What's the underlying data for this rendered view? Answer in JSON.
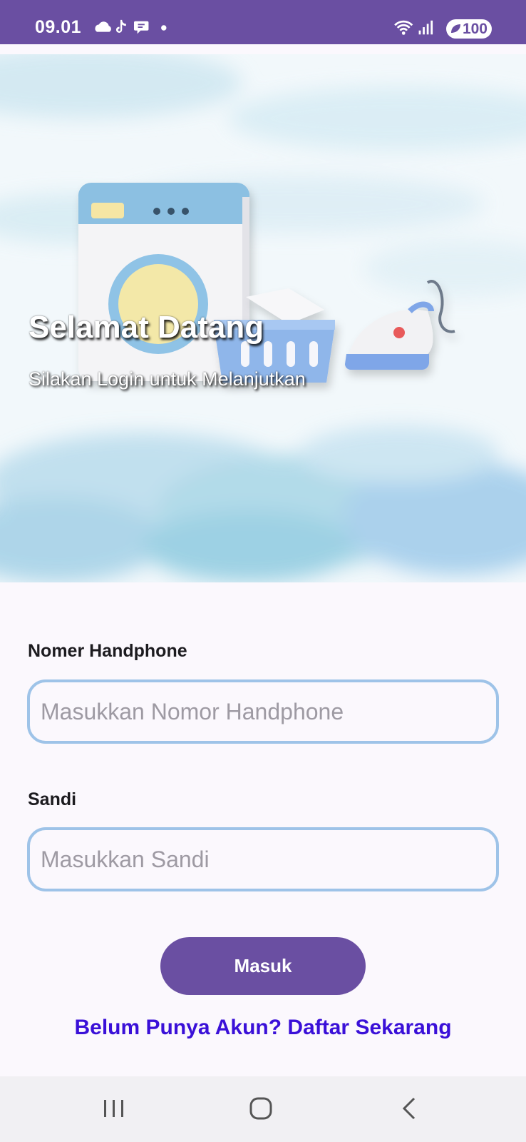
{
  "status_bar": {
    "time": "09.01",
    "battery": "100",
    "left_icons": [
      "cloud-icon",
      "tiktok-icon",
      "chat-bubble-icon",
      "dot-icon"
    ],
    "right_icons": [
      "wifi-icon",
      "signal-icon",
      "battery-icon"
    ]
  },
  "hero": {
    "title": "Selamat Datang",
    "subtitle": "Silakan Login untuk Melanjutkan",
    "illustration": [
      "washing-machine-icon",
      "laundry-basket-icon",
      "iron-icon"
    ]
  },
  "form": {
    "phone": {
      "label": "Nomer Handphone",
      "placeholder": "Masukkan Nomor Handphone",
      "value": ""
    },
    "password": {
      "label": "Sandi",
      "placeholder": "Masukkan Sandi",
      "value": ""
    },
    "submit_label": "Masuk",
    "register_link": "Belum Punya Akun? Daftar Sekarang"
  },
  "nav_bar": {
    "buttons": [
      "recents-icon",
      "home-icon",
      "back-icon"
    ]
  },
  "colors": {
    "primary": "#6a4fa2",
    "input_border": "#9ec3e8",
    "link": "#3a10d8",
    "background": "#fbf8fd"
  }
}
